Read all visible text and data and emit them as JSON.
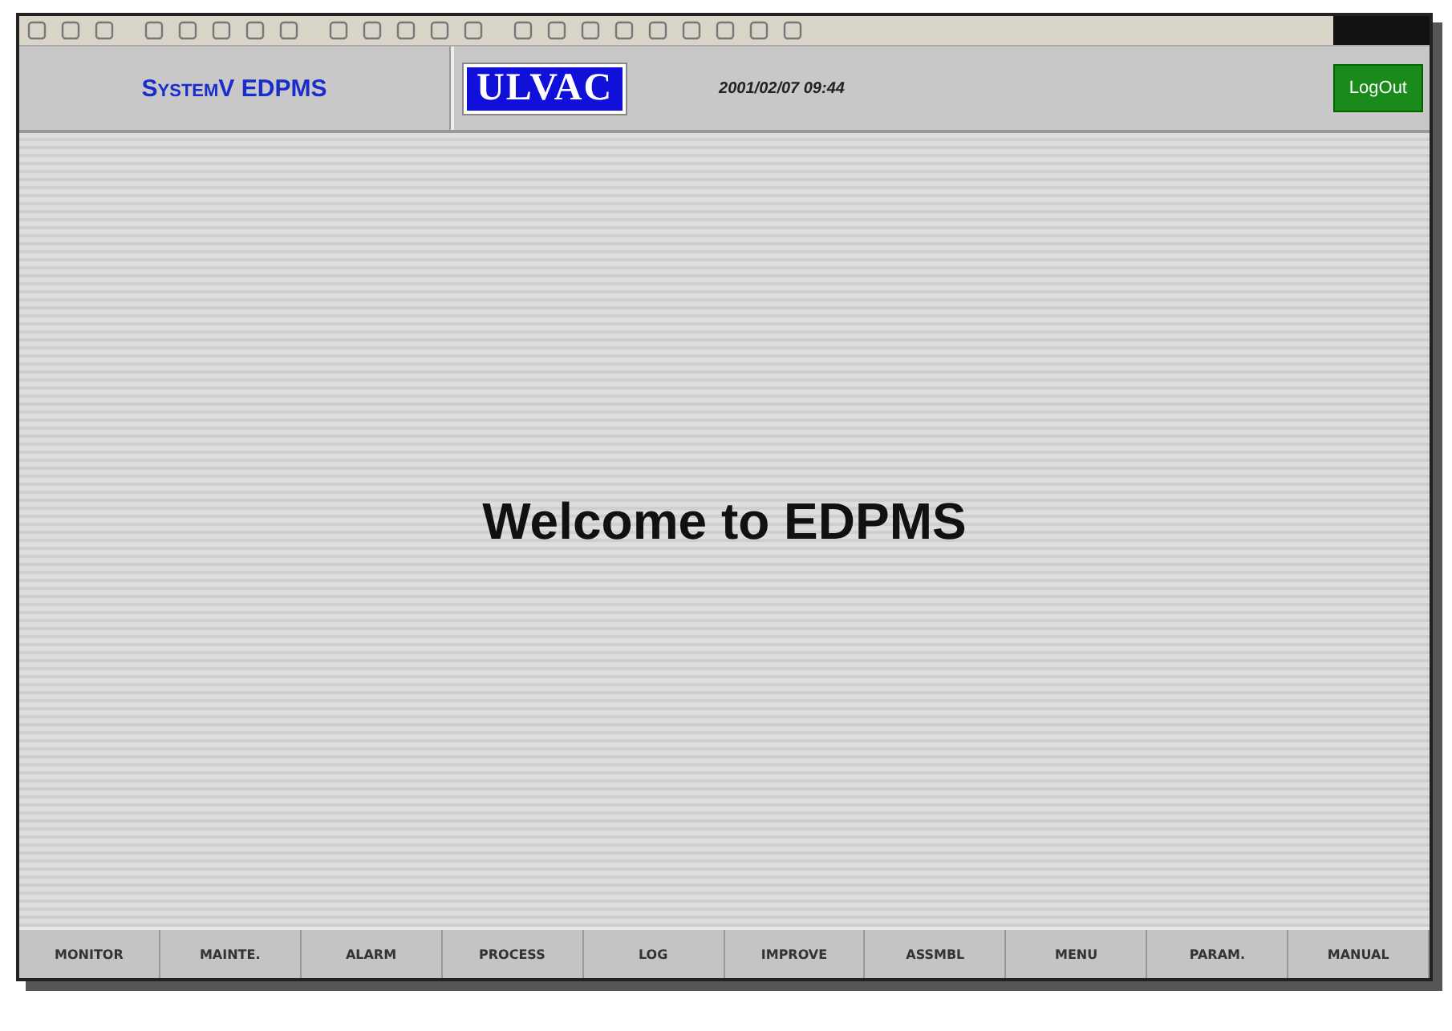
{
  "header": {
    "title": "SystemV EDPMS",
    "logo": "ULVAC",
    "datetime": "2001/02/07 09:44",
    "logout": "LogOut"
  },
  "main": {
    "welcome": "Welcome to EDPMS"
  },
  "tabs": [
    {
      "label": "MONITOR"
    },
    {
      "label": "MAINTE."
    },
    {
      "label": "ALARM"
    },
    {
      "label": "PROCESS"
    },
    {
      "label": "LOG"
    },
    {
      "label": "IMPROVE"
    },
    {
      "label": "ASSMBL"
    },
    {
      "label": "MENU"
    },
    {
      "label": "PARAM."
    },
    {
      "label": "MANUAL"
    }
  ]
}
